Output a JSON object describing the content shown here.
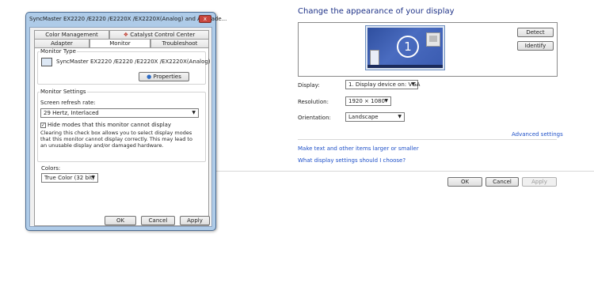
{
  "display_settings": {
    "title": "Change the appearance of your display",
    "monitor_number": "1",
    "detect_label": "Detect",
    "identify_label": "Identify",
    "display_label": "Display:",
    "display_value": "1. Display device on: VGA",
    "resolution_label": "Resolution:",
    "resolution_value": "1920 × 1080",
    "orientation_label": "Orientation:",
    "orientation_value": "Landscape",
    "advanced_link": "Advanced settings",
    "link_text_size": "Make text and other items larger or smaller",
    "link_help": "What display settings should I choose?",
    "ok_label": "OK",
    "cancel_label": "Cancel",
    "apply_label": "Apply"
  },
  "dialog": {
    "title": "SyncMaster EX2220 /E2220 /E2220X /EX2220X(Analog) and ATI Rade...",
    "close_glyph": "x",
    "tabs_row1": [
      "Color Management",
      "Catalyst Control Center"
    ],
    "tabs_row2": [
      "Adapter",
      "Monitor",
      "Troubleshoot"
    ],
    "active_tab": "Monitor",
    "monitor_type_group": "Monitor Type",
    "monitor_name": "SyncMaster EX2220 /E2220 /E2220X /EX2220X(Analog)",
    "properties_label": "Properties",
    "monitor_settings_group": "Monitor Settings",
    "refresh_rate_label": "Screen refresh rate:",
    "refresh_rate_value": "29 Hertz, Interlaced",
    "hide_modes_label": "Hide modes that this monitor cannot display",
    "hide_modes_checked": true,
    "hide_modes_description": "Clearing this check box allows you to select display modes that this monitor cannot display correctly. This may lead to an unusable display and/or damaged hardware.",
    "colors_label": "Colors:",
    "colors_value": "True Color (32 bit)",
    "ok_label": "OK",
    "cancel_label": "Cancel",
    "apply_label": "Apply"
  }
}
